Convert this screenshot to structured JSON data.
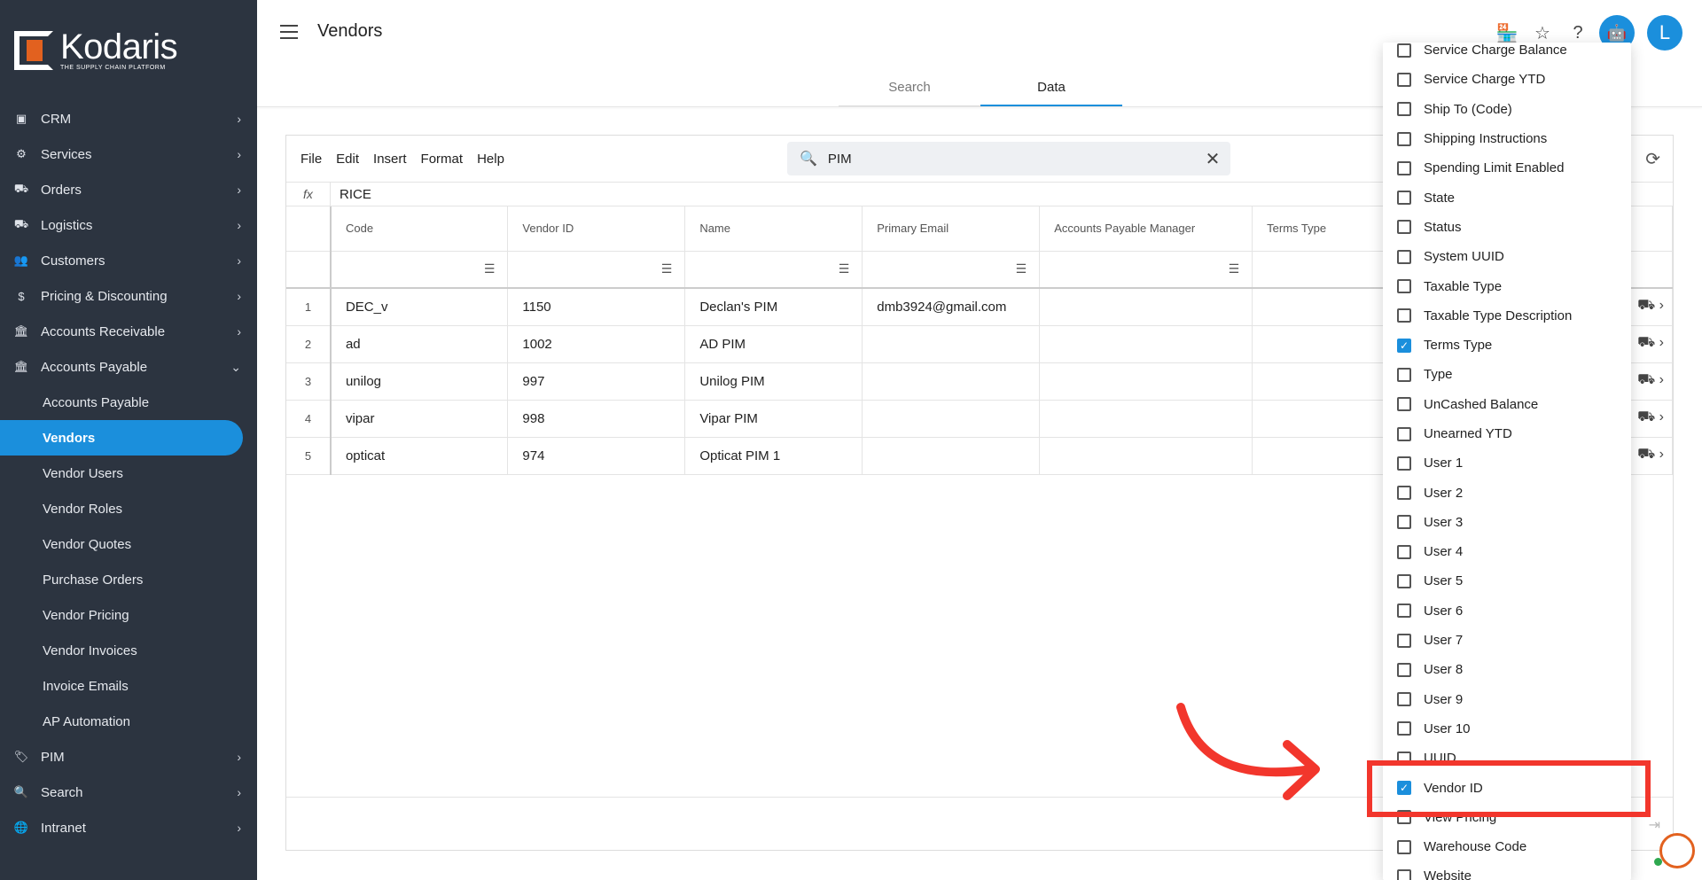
{
  "brand": {
    "name": "Kodaris",
    "tagline": "THE SUPPLY CHAIN PLATFORM",
    "accent": "#1b8fdc",
    "logo_color": "#e2611f"
  },
  "page": {
    "title": "Vendors"
  },
  "header": {
    "user_initial": "L"
  },
  "sidebar": {
    "items": [
      {
        "label": "CRM",
        "icon": "id-card-icon"
      },
      {
        "label": "Services",
        "icon": "services-icon"
      },
      {
        "label": "Orders",
        "icon": "truck-icon"
      },
      {
        "label": "Logistics",
        "icon": "logistics-truck-icon"
      },
      {
        "label": "Customers",
        "icon": "users-icon"
      },
      {
        "label": "Pricing & Discounting",
        "icon": "dollar-icon"
      },
      {
        "label": "Accounts Receivable",
        "icon": "bank-icon"
      },
      {
        "label": "Accounts Payable",
        "icon": "bank-icon"
      }
    ],
    "sub_items": [
      {
        "label": "Accounts Payable"
      },
      {
        "label": "Vendors",
        "active": true
      },
      {
        "label": "Vendor Users"
      },
      {
        "label": "Vendor Roles"
      },
      {
        "label": "Vendor Quotes"
      },
      {
        "label": "Purchase Orders"
      },
      {
        "label": "Vendor Pricing"
      },
      {
        "label": "Vendor Invoices"
      },
      {
        "label": "Invoice Emails"
      },
      {
        "label": "AP Automation"
      }
    ],
    "bottom_items": [
      {
        "label": "PIM",
        "icon": "tag-icon"
      },
      {
        "label": "Search",
        "icon": "search-icon"
      },
      {
        "label": "Intranet",
        "icon": "globe-icon"
      }
    ]
  },
  "tabs": [
    {
      "label": "Search"
    },
    {
      "label": "Data",
      "active": true
    }
  ],
  "toolbar": {
    "menu": [
      "File",
      "Edit",
      "Insert",
      "Format",
      "Help"
    ],
    "search_value": "PIM",
    "formula_label": "fx",
    "formula_value": "RICE"
  },
  "grid": {
    "columns": [
      "Code",
      "Vendor ID",
      "Name",
      "Primary Email",
      "Accounts Payable Manager",
      "Terms Type"
    ],
    "rows": [
      {
        "num": "1",
        "cells": [
          "DEC_v",
          "1150",
          "Declan's PIM",
          "dmb3924@gmail.com",
          "",
          ""
        ]
      },
      {
        "num": "2",
        "cells": [
          "ad",
          "1002",
          "AD PIM",
          "",
          "",
          ""
        ]
      },
      {
        "num": "3",
        "cells": [
          "unilog",
          "997",
          "Unilog PIM",
          "",
          "",
          ""
        ]
      },
      {
        "num": "4",
        "cells": [
          "vipar",
          "998",
          "Vipar PIM",
          "",
          "",
          ""
        ]
      },
      {
        "num": "5",
        "cells": [
          "opticat",
          "974",
          "Opticat PIM 1",
          "",
          "",
          ""
        ]
      }
    ]
  },
  "column_chooser": {
    "options": [
      {
        "label": "Service Charge Balance",
        "checked": false
      },
      {
        "label": "Service Charge YTD",
        "checked": false
      },
      {
        "label": "Ship To (Code)",
        "checked": false
      },
      {
        "label": "Shipping Instructions",
        "checked": false
      },
      {
        "label": "Spending Limit Enabled",
        "checked": false
      },
      {
        "label": "State",
        "checked": false
      },
      {
        "label": "Status",
        "checked": false
      },
      {
        "label": "System UUID",
        "checked": false
      },
      {
        "label": "Taxable Type",
        "checked": false
      },
      {
        "label": "Taxable Type Description",
        "checked": false
      },
      {
        "label": "Terms Type",
        "checked": true
      },
      {
        "label": "Type",
        "checked": false
      },
      {
        "label": "UnCashed Balance",
        "checked": false
      },
      {
        "label": "Unearned YTD",
        "checked": false
      },
      {
        "label": "User 1",
        "checked": false
      },
      {
        "label": "User 2",
        "checked": false
      },
      {
        "label": "User 3",
        "checked": false
      },
      {
        "label": "User 4",
        "checked": false
      },
      {
        "label": "User 5",
        "checked": false
      },
      {
        "label": "User 6",
        "checked": false
      },
      {
        "label": "User 7",
        "checked": false
      },
      {
        "label": "User 8",
        "checked": false
      },
      {
        "label": "User 9",
        "checked": false
      },
      {
        "label": "User 10",
        "checked": false
      },
      {
        "label": "UUID",
        "checked": false
      },
      {
        "label": "Vendor ID",
        "checked": true
      },
      {
        "label": "View Pricing",
        "checked": false
      },
      {
        "label": "Warehouse Code",
        "checked": false
      },
      {
        "label": "Website",
        "checked": false
      }
    ]
  },
  "annotation": {
    "highlight_color": "#f2362c"
  }
}
